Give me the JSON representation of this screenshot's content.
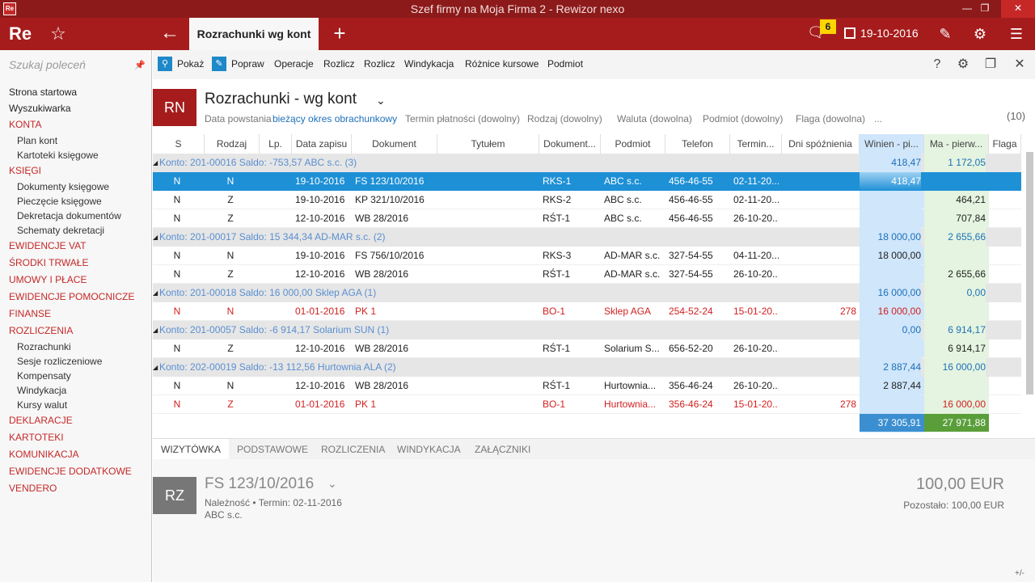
{
  "titlebar": {
    "title": "Szef firmy na Moja Firma 2 - Rewizor nexo",
    "app_icon": "Re"
  },
  "header": {
    "logo": "Re",
    "active_tab": "Rozrachunki wg kont",
    "notifications": "6",
    "date": "19-10-2016"
  },
  "sidebar": {
    "search_placeholder": "Szukaj poleceń",
    "items": [
      {
        "label": "Strona startowa",
        "type": "plain"
      },
      {
        "label": "Wyszukiwarka",
        "type": "plain"
      },
      {
        "label": "KONTA",
        "type": "section"
      },
      {
        "label": "Plan kont",
        "type": "sub"
      },
      {
        "label": "Kartoteki księgowe",
        "type": "sub"
      },
      {
        "label": "KSIĘGI",
        "type": "section"
      },
      {
        "label": "Dokumenty księgowe",
        "type": "sub"
      },
      {
        "label": "Pieczęcie księgowe",
        "type": "sub"
      },
      {
        "label": "Dekretacja dokumentów",
        "type": "sub"
      },
      {
        "label": "Schematy dekretacji",
        "type": "sub"
      },
      {
        "label": "EWIDENCJE VAT",
        "type": "section"
      },
      {
        "label": "ŚRODKI TRWAŁE",
        "type": "section"
      },
      {
        "label": "UMOWY I PŁACE",
        "type": "section"
      },
      {
        "label": "EWIDENCJE POMOCNICZE",
        "type": "section"
      },
      {
        "label": "FINANSE",
        "type": "section"
      },
      {
        "label": "ROZLICZENIA",
        "type": "section"
      },
      {
        "label": "Rozrachunki",
        "type": "sub"
      },
      {
        "label": "Sesje rozliczeniowe",
        "type": "sub"
      },
      {
        "label": "Kompensaty",
        "type": "sub"
      },
      {
        "label": "Windykacja",
        "type": "sub"
      },
      {
        "label": "Kursy walut",
        "type": "sub"
      },
      {
        "label": "DEKLARACJE",
        "type": "section"
      },
      {
        "label": "KARTOTEKI",
        "type": "section"
      },
      {
        "label": "KOMUNIKACJA",
        "type": "section"
      },
      {
        "label": "EWIDENCJE DODATKOWE",
        "type": "section"
      },
      {
        "label": "VENDERO",
        "type": "section"
      }
    ]
  },
  "toolbar": {
    "show": "Pokaż",
    "edit": "Popraw",
    "operations": "Operacje",
    "settle1": "Rozlicz",
    "settle2": "Rozlicz",
    "collection": "Windykacja",
    "fx_diff": "Różnice kursowe",
    "party": "Podmiot",
    "help": "?"
  },
  "doc": {
    "badge": "RN",
    "title": "Rozrachunki - wg kont",
    "filters": [
      {
        "text": "Data powstania",
        "blue": false
      },
      {
        "text": "bieżący okres obrachunkowy",
        "blue": true
      },
      {
        "text": "Termin płatności (dowolny)",
        "blue": false
      },
      {
        "text": "Rodzaj (dowolny)",
        "blue": false
      },
      {
        "text": "Waluta (dowolna)",
        "blue": false
      },
      {
        "text": "Podmiot (dowolny)",
        "blue": false
      },
      {
        "text": "Flaga (dowolna)",
        "blue": false
      },
      {
        "text": "...",
        "blue": false
      }
    ],
    "count": "(10)"
  },
  "grid": {
    "columns": [
      "S",
      "Rodzaj",
      "Lp.",
      "Data zapisu",
      "Dokument",
      "Tytułem",
      "Dokument...",
      "Podmiot",
      "Telefon",
      "Termin...",
      "Dni spóźnienia",
      "Winien - pi...",
      "Ma - pierw...",
      "Flaga"
    ],
    "rows": [
      {
        "kind": "group",
        "label": "Konto: 201-00016   Saldo: -753,57   ABC s.c. (3)",
        "winien": "418,47",
        "ma": "1 172,05"
      },
      {
        "kind": "data",
        "state": "selected",
        "s": "N",
        "rodzaj": "N",
        "lp": "",
        "data": "19-10-2016",
        "dok": "FS 123/10/2016",
        "tyt": "",
        "dok2": "RKS-1",
        "podmiot": "ABC s.c.",
        "tel": "456-46-55",
        "termin": "02-11-20...",
        "dni": "",
        "winien": "418,47",
        "ma": ""
      },
      {
        "kind": "data",
        "state": "normal",
        "s": "N",
        "rodzaj": "Z",
        "lp": "",
        "data": "19-10-2016",
        "dok": "KP 321/10/2016",
        "tyt": "",
        "dok2": "RKS-2",
        "podmiot": "ABC s.c.",
        "tel": "456-46-55",
        "termin": "02-11-20...",
        "dni": "",
        "winien": "",
        "ma": "464,21"
      },
      {
        "kind": "data",
        "state": "normal",
        "s": "N",
        "rodzaj": "Z",
        "lp": "",
        "data": "12-10-2016",
        "dok": "WB 28/2016",
        "tyt": "",
        "dok2": "RŚT-1",
        "podmiot": "ABC s.c.",
        "tel": "456-46-55",
        "termin": "26-10-20...",
        "dni": "",
        "winien": "",
        "ma": "707,84"
      },
      {
        "kind": "group",
        "label": "Konto: 201-00017   Saldo: 15 344,34   AD-MAR s.c. (2)",
        "winien": "18 000,00",
        "ma": "2 655,66"
      },
      {
        "kind": "data",
        "state": "normal",
        "s": "N",
        "rodzaj": "N",
        "lp": "",
        "data": "19-10-2016",
        "dok": "FS 756/10/2016",
        "tyt": "",
        "dok2": "RKS-3",
        "podmiot": "AD-MAR s.c.",
        "tel": "327-54-55",
        "termin": "04-11-20...",
        "dni": "",
        "winien": "18 000,00",
        "ma": ""
      },
      {
        "kind": "data",
        "state": "normal",
        "s": "N",
        "rodzaj": "Z",
        "lp": "",
        "data": "12-10-2016",
        "dok": "WB 28/2016",
        "tyt": "",
        "dok2": "RŚT-1",
        "podmiot": "AD-MAR s.c.",
        "tel": "327-54-55",
        "termin": "26-10-20...",
        "dni": "",
        "winien": "",
        "ma": "2 655,66"
      },
      {
        "kind": "group",
        "label": "Konto: 201-00018   Saldo: 16 000,00   Sklep AGA (1)",
        "winien": "16 000,00",
        "ma": "0,00"
      },
      {
        "kind": "data",
        "state": "red",
        "s": "N",
        "rodzaj": "N",
        "lp": "",
        "data": "01-01-2016",
        "dok": "PK 1",
        "tyt": "",
        "dok2": "BO-1",
        "podmiot": "Sklep AGA",
        "tel": "254-52-24",
        "termin": "15-01-20...",
        "dni": "278",
        "winien": "16 000,00",
        "ma": ""
      },
      {
        "kind": "group",
        "label": "Konto: 201-00057   Saldo: -6 914,17   Solarium SUN (1)",
        "winien": "0,00",
        "ma": "6 914,17"
      },
      {
        "kind": "data",
        "state": "normal",
        "s": "N",
        "rodzaj": "Z",
        "lp": "",
        "data": "12-10-2016",
        "dok": "WB 28/2016",
        "tyt": "",
        "dok2": "RŚT-1",
        "podmiot": "Solarium S...",
        "tel": "656-52-20",
        "termin": "26-10-20...",
        "dni": "",
        "winien": "",
        "ma": "6 914,17"
      },
      {
        "kind": "group",
        "label": "Konto: 202-00019   Saldo: -13 112,56   Hurtownia ALA (2)",
        "winien": "2 887,44",
        "ma": "16 000,00"
      },
      {
        "kind": "data",
        "state": "normal",
        "s": "N",
        "rodzaj": "N",
        "lp": "",
        "data": "12-10-2016",
        "dok": "WB 28/2016",
        "tyt": "",
        "dok2": "RŚT-1",
        "podmiot": "Hurtownia...",
        "tel": "356-46-24",
        "termin": "26-10-20...",
        "dni": "",
        "winien": "2 887,44",
        "ma": ""
      },
      {
        "kind": "data",
        "state": "red",
        "s": "N",
        "rodzaj": "Z",
        "lp": "",
        "data": "01-01-2016",
        "dok": "PK 1",
        "tyt": "",
        "dok2": "BO-1",
        "podmiot": "Hurtownia...",
        "tel": "356-46-24",
        "termin": "15-01-20...",
        "dni": "278",
        "winien": "",
        "ma": "16 000,00"
      }
    ],
    "totals": {
      "winien": "37 305,91",
      "ma": "27 971,88"
    }
  },
  "bottom_tabs": [
    "WIZYTÓWKA",
    "PODSTAWOWE",
    "ROZLICZENIA",
    "WINDYKACJA",
    "ZAŁĄCZNIKI"
  ],
  "card": {
    "badge": "RZ",
    "document": "FS 123/10/2016",
    "type": "Należność",
    "term": "Termin: 02-11-2016",
    "party": "ABC s.c.",
    "amount": "100,00 EUR",
    "remaining": "Pozostało: 100,00 EUR",
    "plusminus": "+/-"
  },
  "colors": {
    "brand": "#a61c1c",
    "accent": "#1e90d6",
    "overdue": "#d32020",
    "winien_bg": "#cfe6fb",
    "ma_bg": "#e4f4e0"
  }
}
